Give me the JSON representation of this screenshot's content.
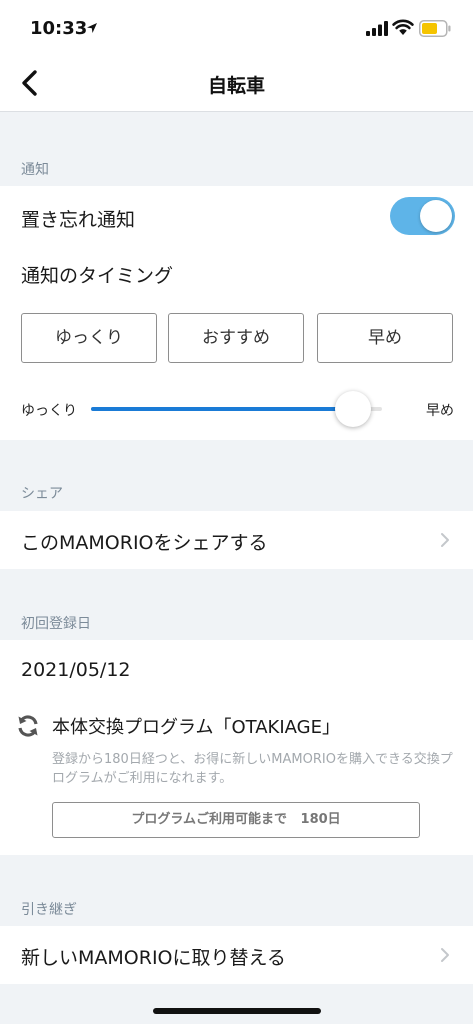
{
  "status_bar": {
    "time": "10:33",
    "icons": [
      "location-arrow-icon",
      "signal-icon",
      "wifi-icon",
      "battery-icon"
    ],
    "battery_color": "#f5c400"
  },
  "nav": {
    "title": "自転車",
    "back_icon": "chevron-left-icon"
  },
  "notification": {
    "header": "通知",
    "left_behind_label": "置き忘れ通知",
    "left_behind_enabled": true,
    "timing_label": "通知のタイミング",
    "timing_buttons": [
      "ゆっくり",
      "おすすめ",
      "早め"
    ],
    "slider": {
      "min_label": "ゆっくり",
      "max_label": "早め",
      "value": 0.9
    }
  },
  "share": {
    "header": "シェア",
    "item_label": "このMAMORIOをシェアする"
  },
  "registration": {
    "header": "初回登録日",
    "date": "2021/05/12",
    "program_title": "本体交換プログラム「OTAKIAGE」",
    "program_desc": "登録から180日経つと、お得に新しいMAMORIOを購入できる交換プログラムがご利用になれます。",
    "program_btn_label": "プログラムご利用可能まで",
    "program_btn_days": "180日"
  },
  "transfer": {
    "header": "引き継ぎ",
    "item_label": "新しいMAMORIOに取り替える"
  },
  "colors": {
    "accent": "#1a7bd6",
    "toggle_on": "#5eb4e8",
    "section_header": "#7c8b99",
    "background": "#f0f3f6"
  }
}
